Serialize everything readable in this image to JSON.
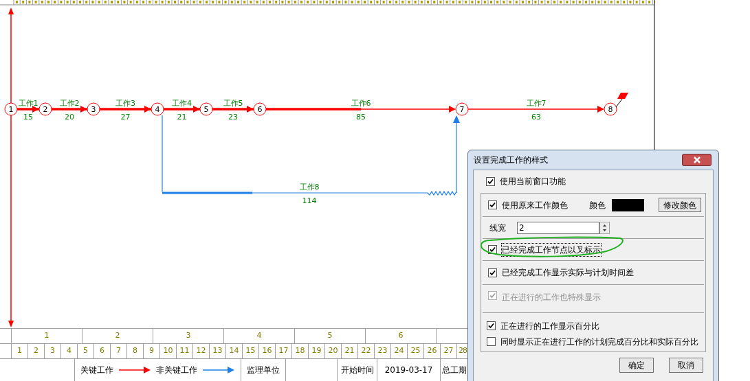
{
  "diagram": {
    "nodes": [
      {
        "label": "1"
      },
      {
        "label": "2"
      },
      {
        "label": "3"
      },
      {
        "label": "4"
      },
      {
        "label": "5"
      },
      {
        "label": "6"
      },
      {
        "label": "7"
      },
      {
        "label": "8"
      }
    ],
    "activities": [
      {
        "name": "工作1",
        "duration": "15",
        "kind": "critical",
        "level": 1
      },
      {
        "name": "工作2",
        "duration": "20",
        "kind": "critical",
        "level": 1
      },
      {
        "name": "工作3",
        "duration": "27",
        "kind": "critical",
        "level": 1
      },
      {
        "name": "工作4",
        "duration": "21",
        "kind": "critical",
        "level": 1
      },
      {
        "name": "工作5",
        "duration": "23",
        "kind": "critical",
        "level": 1
      },
      {
        "name": "工作6",
        "duration": "85",
        "kind": "critical",
        "level": 0.5
      },
      {
        "name": "工作7",
        "duration": "63",
        "kind": "critical"
      },
      {
        "name": "工作8",
        "duration": "114",
        "kind": "noncritical",
        "level": 0.34
      }
    ]
  },
  "timescale": {
    "months": [
      "1",
      "2",
      "3",
      "4",
      "5",
      "6"
    ],
    "weeks": [
      "1",
      "2",
      "3",
      "4",
      "5",
      "6",
      "7",
      "8",
      "9",
      "10",
      "11",
      "12",
      "13",
      "14",
      "15",
      "16",
      "17",
      "18",
      "19",
      "20",
      "21",
      "22",
      "23",
      "24",
      "25",
      "26",
      "27",
      "28"
    ]
  },
  "legend": {
    "critical_label": "关键工作",
    "noncritical_label": "非关键工作",
    "supervisor_label": "监理单位",
    "start_label": "开始时间",
    "start_date": "2019-03-17",
    "duration_label": "总工期"
  },
  "dialog": {
    "title": "设置完成工作的样式",
    "use_window": {
      "label": "使用当前窗口功能",
      "checked": true
    },
    "use_original_color": {
      "label": "使用原来工作颜色",
      "checked": true
    },
    "color_label": "颜色",
    "change_color_button": "修改颜色",
    "line_width": {
      "label": "线宽",
      "value": "2"
    },
    "options": [
      {
        "label": "已经完成工作节点以叉标示",
        "checked": true,
        "disabled": false,
        "focused": true
      },
      {
        "label": "已经完成工作显示实际与计划时间差",
        "checked": true,
        "disabled": false,
        "focused": false
      },
      {
        "label": "正在进行的工作也特殊显示",
        "checked": true,
        "disabled": true,
        "focused": false
      },
      {
        "label": "正在进行的工作显示百分比",
        "checked": true,
        "disabled": false,
        "focused": false
      },
      {
        "label": "同时显示正在进行工作的计划完成百分比和实际百分比",
        "checked": false,
        "disabled": false,
        "focused": false
      }
    ],
    "buttons": [
      "确定",
      "取消"
    ]
  }
}
